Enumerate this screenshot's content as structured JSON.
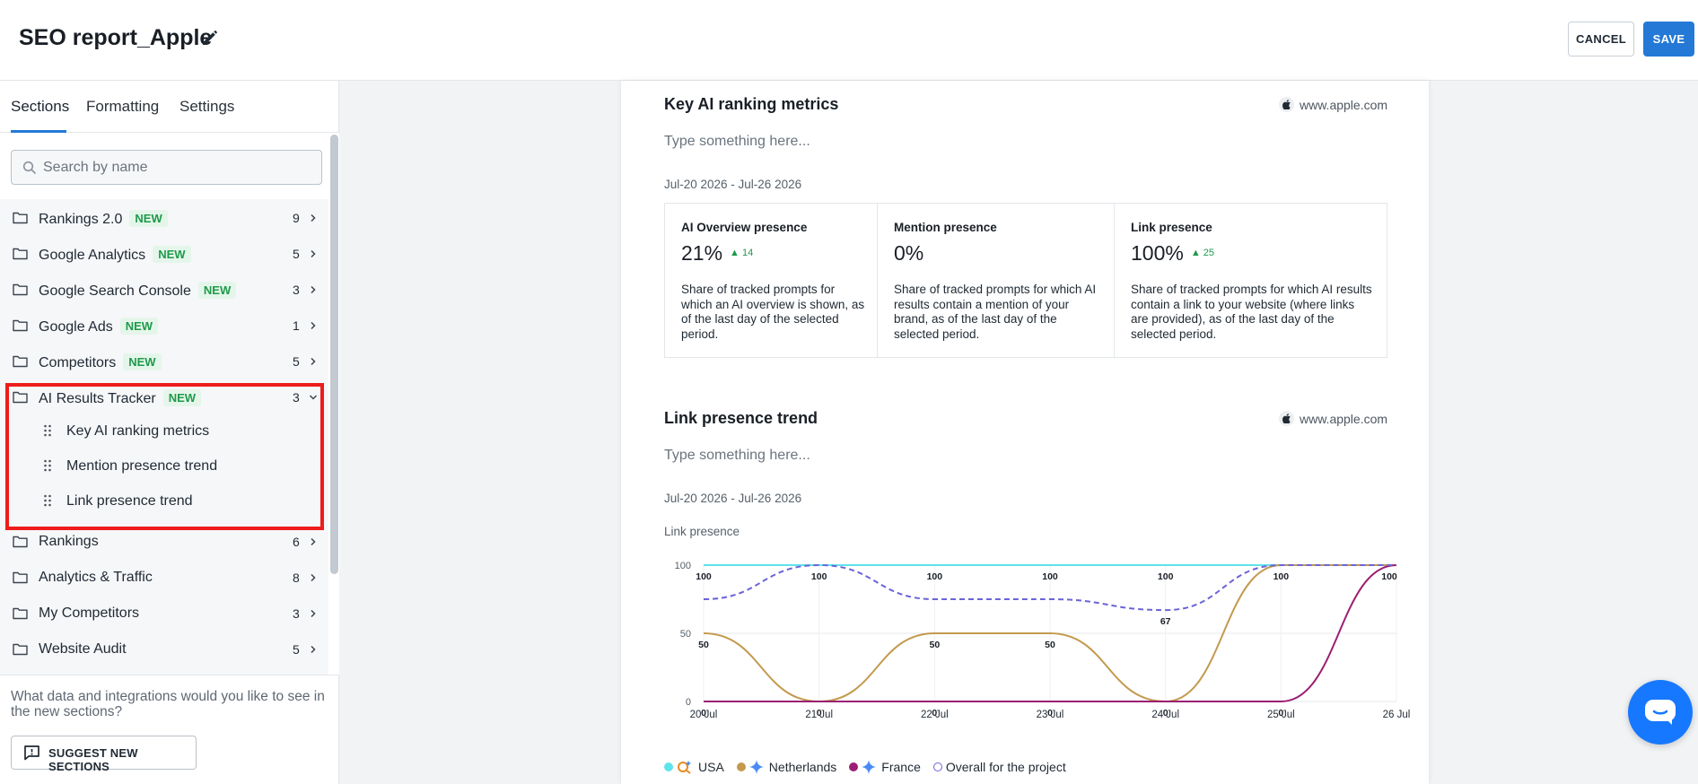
{
  "header": {
    "title": "SEO report_Apple",
    "cancel_label": "CANCEL",
    "save_label": "SAVE"
  },
  "sidebar": {
    "tabs": [
      "Sections",
      "Formatting",
      "Settings"
    ],
    "search_placeholder": "Search by name",
    "badge": "NEW",
    "items": [
      {
        "label": "Rankings 2.0",
        "count": "9",
        "new": true
      },
      {
        "label": "Google Analytics",
        "count": "5",
        "new": true
      },
      {
        "label": "Google Search Console",
        "count": "3",
        "new": true
      },
      {
        "label": "Google Ads",
        "count": "1",
        "new": true
      },
      {
        "label": "Competitors",
        "count": "5",
        "new": true
      },
      {
        "label": "AI Results Tracker",
        "count": "3",
        "new": true,
        "expanded": true,
        "children": [
          "Key AI ranking metrics",
          "Mention presence trend",
          "Link presence trend"
        ]
      },
      {
        "label": "Rankings",
        "count": "6",
        "new": false
      },
      {
        "label": "Analytics & Traffic",
        "count": "8",
        "new": false
      },
      {
        "label": "My Competitors",
        "count": "3",
        "new": false
      },
      {
        "label": "Website Audit",
        "count": "5",
        "new": false
      }
    ],
    "question": "What data and integrations would you like to see in the new sections?",
    "suggest_label": "SUGGEST NEW SECTIONS"
  },
  "report": {
    "key_metrics": {
      "title": "Key AI ranking metrics",
      "domain": "www.apple.com",
      "note_placeholder": "Type something here...",
      "period": "Jul-20 2026 - Jul-26 2026",
      "metrics": [
        {
          "name": "AI Overview presence",
          "value": "21%",
          "delta": "14",
          "desc": "Share of tracked prompts for which an AI overview is shown, as of the last day of the selected period."
        },
        {
          "name": "Mention presence",
          "value": "0%",
          "delta": "",
          "desc": "Share of tracked prompts for which AI results contain a mention of your brand, as of the last day of the selected period."
        },
        {
          "name": "Link presence",
          "value": "100%",
          "delta": "25",
          "desc": "Share of tracked prompts for which AI results contain a link to your website (where links are provided), as of the last day of the selected period."
        }
      ]
    },
    "link_trend": {
      "title": "Link presence trend",
      "domain": "www.apple.com",
      "note_placeholder": "Type something here...",
      "period": "Jul-20 2026 - Jul-26 2026",
      "chart_label": "Link presence"
    }
  },
  "chart_data": {
    "type": "line",
    "categories": [
      "20 Jul",
      "21 Jul",
      "22 Jul",
      "23 Jul",
      "24 Jul",
      "25 Jul",
      "26 Jul"
    ],
    "ylim": [
      0,
      100
    ],
    "yticks": [
      0,
      50,
      100
    ],
    "grid": true,
    "legend": "bottom-left",
    "series": [
      {
        "name": "USA",
        "color": "#5fe3ea",
        "dashed": false,
        "values": [
          100,
          100,
          100,
          100,
          100,
          100,
          100
        ],
        "labels": false
      },
      {
        "name": "Netherlands",
        "color": "#c39a4e",
        "dashed": false,
        "values": [
          50,
          0,
          50,
          50,
          0,
          100,
          100
        ],
        "labels": true
      },
      {
        "name": "France",
        "color": "#9c1f73",
        "dashed": false,
        "values": [
          0,
          0,
          0,
          0,
          0,
          0,
          100
        ],
        "labels": true
      },
      {
        "name": "Overall for the project",
        "color": "#6b63d8",
        "dashed": true,
        "values": [
          75,
          100,
          75,
          75,
          67,
          100,
          100
        ],
        "labels": true
      }
    ],
    "point_labels": [
      [
        "100",
        "50",
        "0"
      ],
      [
        "100",
        "0"
      ],
      [
        "100",
        "50",
        "0"
      ],
      [
        "100",
        "50",
        "0"
      ],
      [
        "100",
        "67",
        "0"
      ],
      [
        "100",
        "0"
      ],
      [
        "100"
      ]
    ]
  }
}
